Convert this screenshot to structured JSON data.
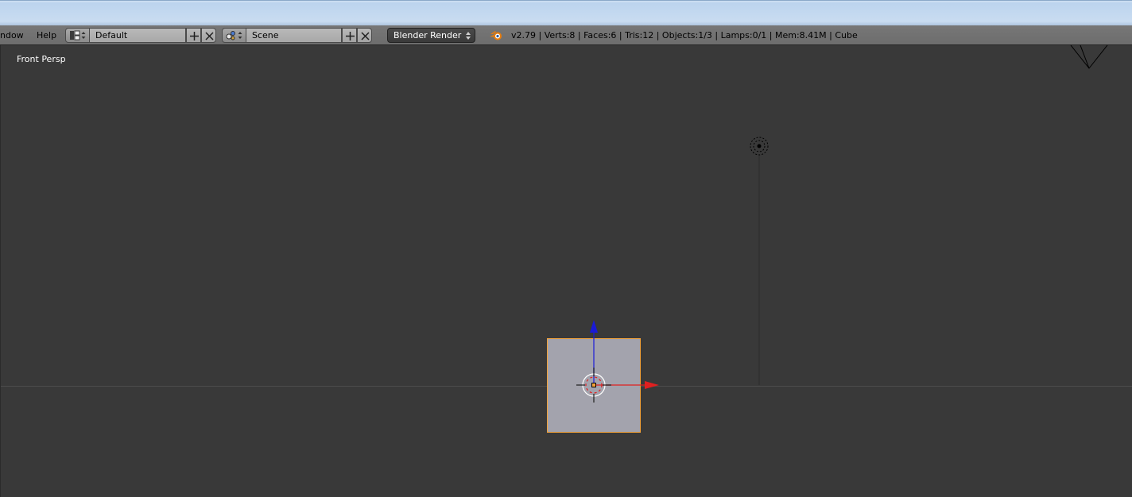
{
  "header": {
    "menu": {
      "window": "ndow",
      "help": "Help"
    },
    "screen_layout": {
      "icon": "screen-layout-icon",
      "name": "Default"
    },
    "scene": {
      "icon": "scene-icon",
      "name": "Scene"
    },
    "render_engine": "Blender Render",
    "stats": "v2.79 | Verts:8 | Faces:6 | Tris:12 | Objects:1/3 | Lamps:0/1 | Mem:8.41M | Cube"
  },
  "viewport": {
    "view_label": "Front Persp",
    "objects": {
      "selected": "Cube",
      "lamp": "lamp",
      "camera": "camera"
    },
    "colors": {
      "background": "#393939",
      "cube_fill": "#a3a3ad",
      "selection_outline": "#f2a23b",
      "x_axis": "#e02020",
      "z_axis": "#1a1ad8"
    }
  }
}
